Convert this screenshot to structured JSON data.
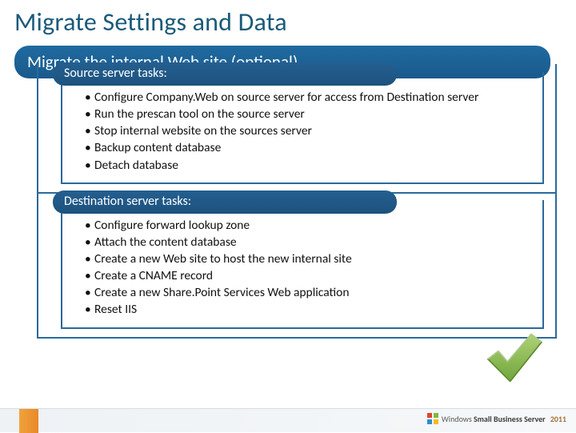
{
  "title": "Migrate Settings and Data",
  "subtitle": "Migrate the internal Web site (optional)",
  "sections": [
    {
      "heading": "Source server tasks:",
      "items": [
        "Configure Company.Web on source server for access from Destination server",
        "Run the prescan tool on the source server",
        "Stop internal website on the sources server",
        "Backup content database",
        "Detach database"
      ]
    },
    {
      "heading": "Destination server tasks:",
      "items": [
        "Configure forward lookup zone",
        " Attach the content database",
        "Create a new Web site to host the new internal site",
        "Create a CNAME record",
        "Create a new Share.Point Services Web application",
        "Reset IIS"
      ]
    }
  ],
  "footer": {
    "brand_prefix": "Windows",
    "brand_main": "Small Business Server",
    "year": "2011"
  }
}
